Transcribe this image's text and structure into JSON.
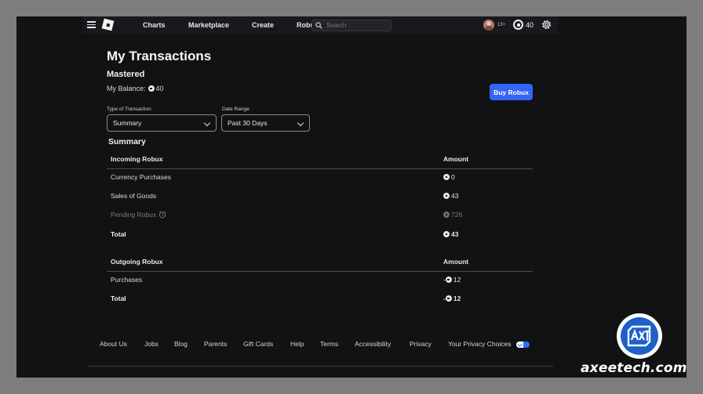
{
  "nav": {
    "links": [
      "Charts",
      "Marketplace",
      "Create",
      "Robux"
    ],
    "search_placeholder": "Search",
    "age_badge": "13+",
    "robux_balance": "40"
  },
  "page": {
    "title": "My Transactions",
    "username": "Mastered",
    "balance_label": "My Balance:",
    "balance_value": "40",
    "buy_button": "Buy Robux"
  },
  "filters": {
    "type_label": "Type of Transaction",
    "type_value": "Summary",
    "range_label": "Date Range",
    "range_value": "Past 30 Days"
  },
  "summary": {
    "title": "Summary",
    "incoming": {
      "header": "Incoming Robux",
      "amount_header": "Amount",
      "rows": [
        {
          "label": "Currency Purchases",
          "amount": "0"
        },
        {
          "label": "Sales of Goods",
          "amount": "43"
        },
        {
          "label": "Pending Robux",
          "amount": "726"
        },
        {
          "label": "Total",
          "amount": "43"
        }
      ]
    },
    "outgoing": {
      "header": "Outgoing Robux",
      "amount_header": "Amount",
      "rows": [
        {
          "label": "Purchases",
          "amount": "-",
          "value": "12"
        },
        {
          "label": "Total",
          "amount": "-",
          "value": "12"
        }
      ]
    }
  },
  "footer": {
    "links": [
      "About Us",
      "Jobs",
      "Blog",
      "Parents",
      "Gift Cards",
      "Help",
      "Terms",
      "Accessibility",
      "Privacy",
      "Your Privacy Choices"
    ]
  },
  "watermark": {
    "site": "axeetech.com",
    "logo_letters": "axt"
  },
  "colors": {
    "background": "#111214",
    "topbar": "#18191c",
    "accent_button": "#3465f5",
    "outer_frame": "#7d7d7d"
  }
}
